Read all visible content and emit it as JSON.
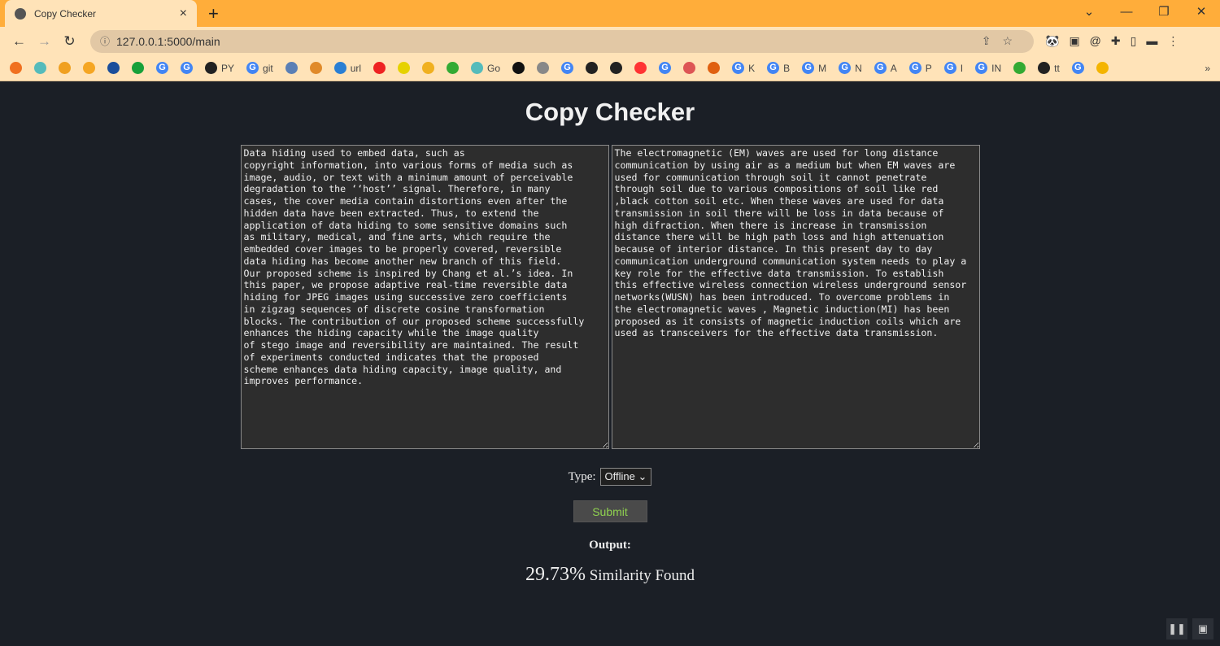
{
  "browser": {
    "tab_title": "Copy Checker",
    "url": "127.0.0.1:5000/main",
    "bookmarks": [
      {
        "label": "",
        "icon": "diamond-icon",
        "color": "#f07020"
      },
      {
        "label": "",
        "icon": "shield-icon",
        "color": "#5bb"
      },
      {
        "label": "",
        "icon": "wallet-icon",
        "color": "#f0a020"
      },
      {
        "label": "",
        "icon": "bars-icon",
        "color": "#f5a623"
      },
      {
        "label": "",
        "icon": "ieee-icon",
        "color": "#1b4e9b"
      },
      {
        "label": "",
        "icon": "number-3-icon",
        "color": "#17a03a"
      },
      {
        "label": "",
        "icon": "google-icon",
        "color": "#4285f4"
      },
      {
        "label": "",
        "icon": "google-icon",
        "color": "#4285f4"
      },
      {
        "label": "PY",
        "icon": "github-icon",
        "color": "#222"
      },
      {
        "label": "git",
        "icon": "google-icon",
        "color": "#4285f4"
      },
      {
        "label": "",
        "icon": "plug-icon",
        "color": "#5a7fb5"
      },
      {
        "label": "",
        "icon": "pma-icon",
        "color": "#e08a2a"
      },
      {
        "label": "url",
        "icon": "wifi-icon",
        "color": "#2a7fd4"
      },
      {
        "label": "",
        "icon": "youtube-icon",
        "color": "#e22"
      },
      {
        "label": "",
        "icon": "p-icon",
        "color": "#e6d200"
      },
      {
        "label": "",
        "icon": "camera-icon",
        "color": "#f0b020"
      },
      {
        "label": "",
        "icon": "ring-icon",
        "color": "#3a3"
      },
      {
        "label": "Go",
        "icon": "shield-icon",
        "color": "#5bb"
      },
      {
        "label": "",
        "icon": "penguin-icon",
        "color": "#111"
      },
      {
        "label": "",
        "icon": "figure-icon",
        "color": "#888"
      },
      {
        "label": "",
        "icon": "google-icon",
        "color": "#4285f4"
      },
      {
        "label": "",
        "icon": "globe-icon",
        "color": "#222"
      },
      {
        "label": "",
        "icon": "globe-icon",
        "color": "#222"
      },
      {
        "label": "",
        "icon": "yandex-icon",
        "color": "#f33"
      },
      {
        "label": "",
        "icon": "google-icon",
        "color": "#4285f4"
      },
      {
        "label": "",
        "icon": "matlab-icon",
        "color": "#d55"
      },
      {
        "label": "",
        "icon": "eye-icon",
        "color": "#e06010"
      },
      {
        "label": "K",
        "icon": "google-icon",
        "color": "#4285f4"
      },
      {
        "label": "B",
        "icon": "google-icon",
        "color": "#4285f4"
      },
      {
        "label": "M",
        "icon": "google-icon",
        "color": "#4285f4"
      },
      {
        "label": "N",
        "icon": "google-icon",
        "color": "#4285f4"
      },
      {
        "label": "A",
        "icon": "google-icon",
        "color": "#4285f4"
      },
      {
        "label": "P",
        "icon": "google-icon",
        "color": "#4285f4"
      },
      {
        "label": "I",
        "icon": "google-icon",
        "color": "#4285f4"
      },
      {
        "label": "IN",
        "icon": "google-icon",
        "color": "#4285f4"
      },
      {
        "label": "",
        "icon": "speaker-icon",
        "color": "#3a3"
      },
      {
        "label": "tt",
        "icon": "bus-icon",
        "color": "#222"
      },
      {
        "label": "",
        "icon": "google-icon",
        "color": "#4285f4"
      },
      {
        "label": "",
        "icon": "pinwheel-icon",
        "color": "#f4b400"
      }
    ]
  },
  "page": {
    "title": "Copy Checker",
    "text1": "Data hiding used to embed data, such as\ncopyright information, into various forms of media such as\nimage, audio, or text with a minimum amount of perceivable\ndegradation to the ‘‘host’’ signal. Therefore, in many\ncases, the cover media contain distortions even after the\nhidden data have been extracted. Thus, to extend the\napplication of data hiding to some sensitive domains such\nas military, medical, and fine arts, which require the\nembedded cover images to be properly covered, reversible\ndata hiding has become another new branch of this field.\nOur proposed scheme is inspired by Chang et al.’s idea. In\nthis paper, we propose adaptive real-time reversible data\nhiding for JPEG images using successive zero coefficients\nin zigzag sequences of discrete cosine transformation\nblocks. The contribution of our proposed scheme successfully\nenhances the hiding capacity while the image quality\nof stego image and reversibility are maintained. The result\nof experiments conducted indicates that the proposed\nscheme enhances data hiding capacity, image quality, and\nimproves performance.",
    "text2": "The electromagnetic (EM) waves are used for long distance\ncommunication by using air as a medium but when EM waves are\nused for communication through soil it cannot penetrate\nthrough soil due to various compositions of soil like red\n,black cotton soil etc. When these waves are used for data\ntransmission in soil there will be loss in data because of\nhigh difraction. When there is increase in transmission\ndistance there will be high path loss and high attenuation\nbecause of interior distance. In this present day to day\ncommunication underground communication system needs to play a\nkey role for the effective data transmission. To establish\nthis effective wireless connection wireless underground sensor\nnetworks(WUSN) has been introduced. To overcome problems in\nthe electromagnetic waves , Magnetic induction(MI) has been\nproposed as it consists of magnetic induction coils which are\nused as transceivers for the effective data transmission.",
    "type_label": "Type:",
    "type_value": "Offline",
    "submit_label": "Submit",
    "output_label": "Output:",
    "similarity_percent": "29.73%",
    "similarity_text": "Similarity Found"
  }
}
